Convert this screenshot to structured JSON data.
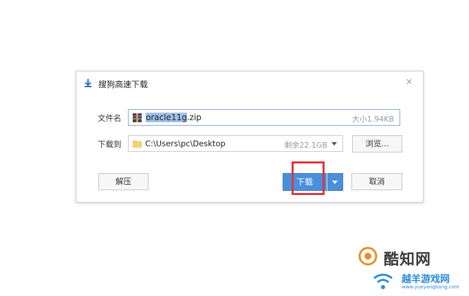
{
  "dialog": {
    "title": "搜狗高速下载",
    "close_symbol": "×"
  },
  "filename_row": {
    "label": "文件名",
    "value_selected": "oracle11g",
    "value_ext": ".zip",
    "size": "大小1.94KB"
  },
  "path_row": {
    "label": "下载到",
    "value": "C:\\Users\\pc\\Desktop",
    "free_space": "剩余22.1GB"
  },
  "buttons": {
    "browse": "浏览...",
    "extract": "解压",
    "download": "下载",
    "cancel": "取消"
  },
  "icons": {
    "title": "download-arrow-icon",
    "file": "winrar-archive-icon",
    "folder": "folder-icon",
    "close": "close-icon"
  },
  "colors": {
    "primary_button": "#4a8fdb",
    "highlight": "#e0353b",
    "selection": "#9fc0e8"
  },
  "watermarks": {
    "brand1": "酷知网",
    "brand2": "越羊游戏网",
    "brand2_url": "www.yueyangbang.com"
  }
}
